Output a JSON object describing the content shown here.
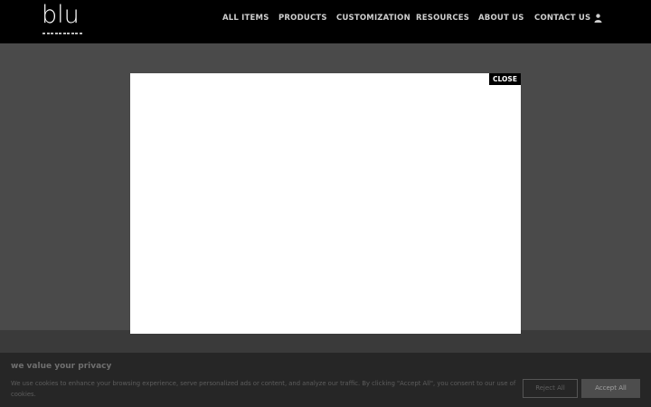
{
  "header": {
    "logo_text": "blu",
    "nav": [
      {
        "label": "ALL ITEMS"
      },
      {
        "label": "PRODUCTS"
      },
      {
        "label": "CUSTOMIZATION"
      },
      {
        "label": "RESOURCES"
      },
      {
        "label": "ABOUT US"
      },
      {
        "label": "CONTACT US"
      }
    ],
    "user_icon": "user-icon"
  },
  "modal": {
    "close_label": "CLOSE"
  },
  "cookie_banner": {
    "title": "we value your privacy",
    "text": "We use cookies to enhance your browsing experience, serve personalized ads or content, and analyze our traffic. By clicking \"Accept All\", you consent to our use of cookies.",
    "reject_label": "Reject All",
    "accept_label": "Accept All"
  },
  "colors": {
    "header_bg": "#000000",
    "overlay": "#4a4a4a",
    "banner_bg": "#262626"
  }
}
